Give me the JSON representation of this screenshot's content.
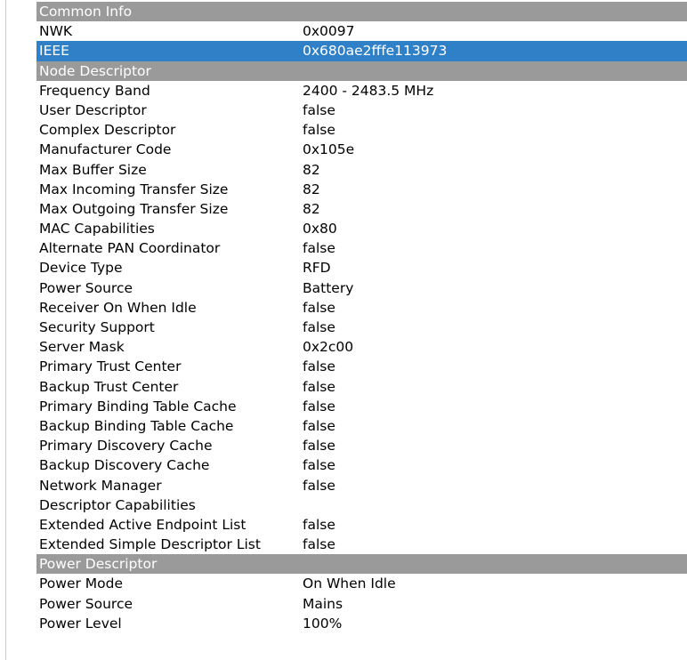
{
  "sections": {
    "common": {
      "title": "Common Info",
      "rows": [
        {
          "key": "NWK",
          "value": "0x0097"
        },
        {
          "key": "IEEE",
          "value": "0x680ae2fffe113973"
        }
      ]
    },
    "node": {
      "title": "Node Descriptor",
      "rows": [
        {
          "key": "Frequency Band",
          "value": "2400 - 2483.5 MHz"
        },
        {
          "key": "User Descriptor",
          "value": "false"
        },
        {
          "key": "Complex Descriptor",
          "value": "false"
        },
        {
          "key": "Manufacturer Code",
          "value": "0x105e"
        },
        {
          "key": "Max Buffer Size",
          "value": "82"
        },
        {
          "key": "Max Incoming Transfer Size",
          "value": "82"
        },
        {
          "key": "Max Outgoing Transfer Size",
          "value": "82"
        },
        {
          "key": "MAC Capabilities",
          "value": "0x80"
        },
        {
          "key": "Alternate PAN Coordinator",
          "value": "false"
        },
        {
          "key": "Device Type",
          "value": "RFD"
        },
        {
          "key": "Power Source",
          "value": "Battery"
        },
        {
          "key": "Receiver On When Idle",
          "value": "false"
        },
        {
          "key": "Security Support",
          "value": "false"
        },
        {
          "key": "Server Mask",
          "value": "0x2c00"
        },
        {
          "key": "Primary Trust Center",
          "value": "false"
        },
        {
          "key": "Backup Trust Center",
          "value": "false"
        },
        {
          "key": "Primary Binding Table Cache",
          "value": "false"
        },
        {
          "key": "Backup Binding Table Cache",
          "value": "false"
        },
        {
          "key": "Primary Discovery Cache",
          "value": "false"
        },
        {
          "key": "Backup Discovery Cache",
          "value": "false"
        },
        {
          "key": "Network Manager",
          "value": "false"
        },
        {
          "key": "Descriptor Capabilities",
          "value": ""
        },
        {
          "key": "Extended Active Endpoint List",
          "value": "false"
        },
        {
          "key": "Extended Simple Descriptor List",
          "value": "false"
        }
      ]
    },
    "power": {
      "title": "Power Descriptor",
      "rows": [
        {
          "key": "Power Mode",
          "value": "On When Idle"
        },
        {
          "key": "Power Source",
          "value": "Mains"
        },
        {
          "key": "Power Level",
          "value": "100%"
        }
      ]
    }
  },
  "selected_row": "sections.common.rows.1",
  "colors": {
    "section_header_bg": "#9a9a9a",
    "selected_bg": "#2f80c6"
  }
}
